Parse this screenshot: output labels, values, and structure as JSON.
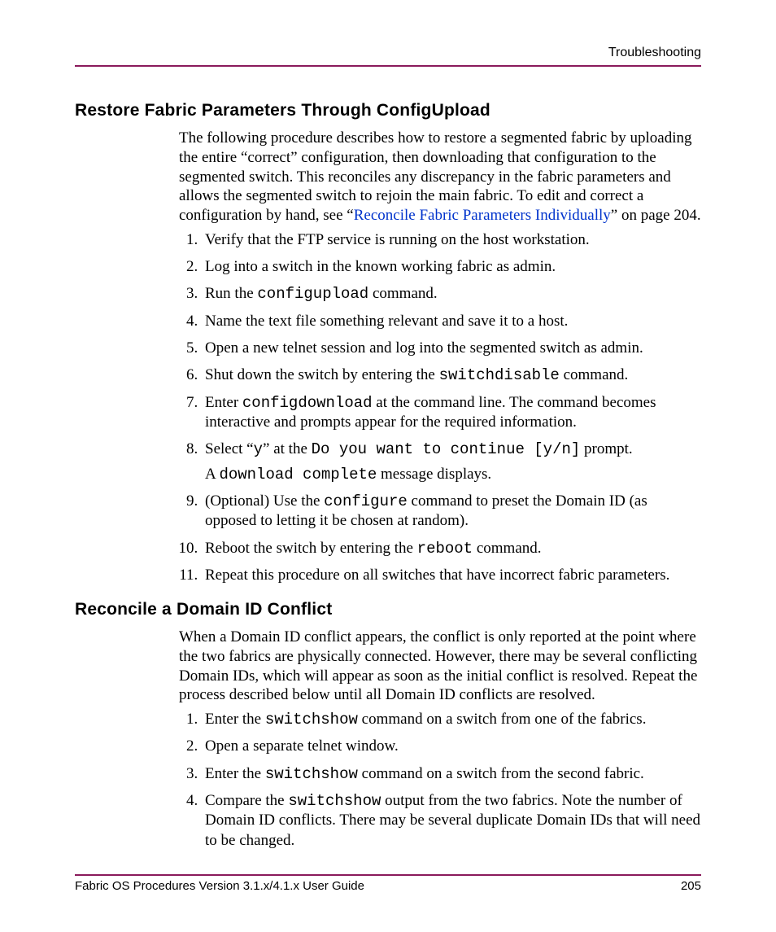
{
  "header": {
    "running": "Troubleshooting"
  },
  "section1": {
    "title": "Restore Fabric Parameters Through ConfigUpload",
    "intro_pre": "The following procedure describes how to restore a segmented fabric by uploading the entire “correct” configuration, then downloading that configuration to the segmented switch. This reconciles any discrepancy in the fabric parameters and allows the segmented switch to rejoin the main fabric. To edit and correct a configuration by hand, see “",
    "intro_link": "Reconcile Fabric Parameters Individually",
    "intro_post": "” on page 204.",
    "steps": {
      "s1": "Verify that the FTP service is running on the host workstation.",
      "s2": "Log into a switch in the known working fabric as admin.",
      "s3_a": "Run the ",
      "s3_cmd": "configupload",
      "s3_b": " command.",
      "s4": "Name the text file something relevant and save it to a host.",
      "s5": "Open a new telnet session and log into the segmented switch as admin.",
      "s6_a": "Shut down the switch by entering the ",
      "s6_cmd": "switchdisable",
      "s6_b": " command.",
      "s7_a": "Enter ",
      "s7_cmd": "configdownload",
      "s7_b": " at the command line. The command becomes interactive and prompts appear for the required information.",
      "s8_a": "Select “",
      "s8_y": "y",
      "s8_b": "” at the ",
      "s8_prompt": "Do you want to continue [y/n]",
      "s8_c": " prompt.",
      "s8_sub_a": "A ",
      "s8_sub_cmd": "download complete",
      "s8_sub_b": " message displays.",
      "s9_a": "(Optional) Use the ",
      "s9_cmd": "configure",
      "s9_b": " command to preset the Domain ID (as opposed to letting it be chosen at random).",
      "s10_a": "Reboot the switch by entering the ",
      "s10_cmd": "reboot",
      "s10_b": " command.",
      "s11": "Repeat this procedure on all switches that have incorrect fabric parameters."
    }
  },
  "section2": {
    "title": "Reconcile a Domain ID Conflict",
    "intro": "When a Domain ID conflict appears, the conflict is only reported at the point where the two fabrics are physically connected. However, there may be several conflicting Domain IDs, which will appear as soon as the initial conflict is resolved. Repeat the process described below until all Domain ID conflicts are resolved.",
    "steps": {
      "s1_a": "Enter the ",
      "s1_cmd": "switchshow",
      "s1_b": " command on a switch from one of the fabrics.",
      "s2": "Open a separate telnet window.",
      "s3_a": "Enter the ",
      "s3_cmd": "switchshow",
      "s3_b": " command on a switch from the second fabric.",
      "s4_a": "Compare the ",
      "s4_cmd": "switchshow",
      "s4_b": " output from the two fabrics. Note the number of Domain ID conflicts. There may be several duplicate Domain IDs that will need to be changed."
    }
  },
  "footer": {
    "left": "Fabric OS Procedures Version 3.1.x/4.1.x User Guide",
    "right": "205"
  }
}
